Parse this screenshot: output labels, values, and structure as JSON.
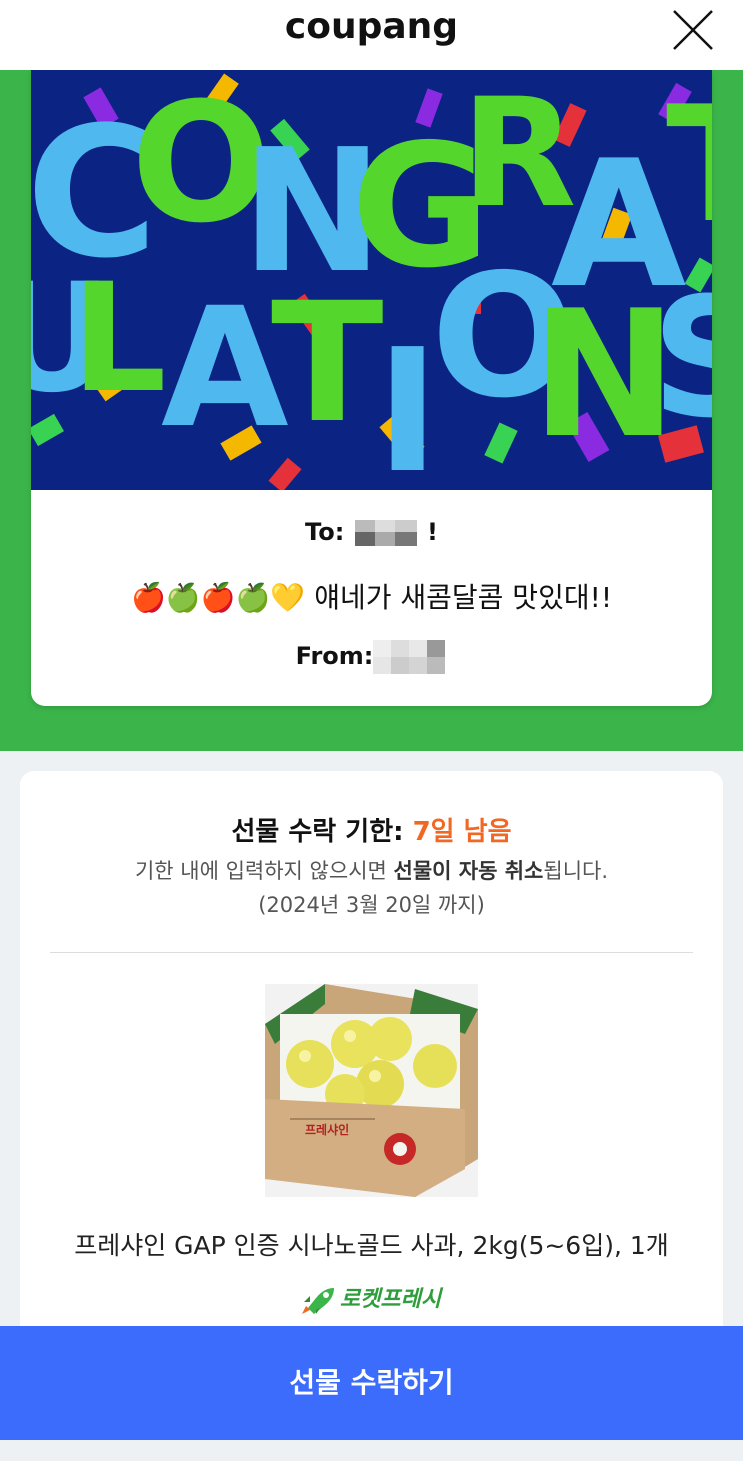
{
  "header": {
    "logo": "coupang"
  },
  "banner": {
    "text": "CONGRATULATIONS"
  },
  "card": {
    "to_label": "To:",
    "to_suffix": "!",
    "message_emoji": "🍎🍏🍎🍏💛",
    "message_text": "얘네가 새콤달콤 맛있대!!",
    "from_label": "From:"
  },
  "info": {
    "deadline_label": "선물 수락 기한:",
    "deadline_value": "7일 남음",
    "notice_pre": "기한 내에 입력하지 않으시면 ",
    "notice_bold": "선물이 자동 취소",
    "notice_post": "됩니다.",
    "date": "(2024년 3월 20일 까지)",
    "product_name": "프레샤인 GAP 인증 시나노골드 사과, 2kg(5~6입), 1개",
    "badge": "로켓프레시"
  },
  "footer": {
    "accept_label": "선물 수락하기"
  },
  "colors": {
    "green": "#3bb54a",
    "banner_bg": "#0b2383",
    "button": "#3c6cfc",
    "orange": "#f26722"
  }
}
